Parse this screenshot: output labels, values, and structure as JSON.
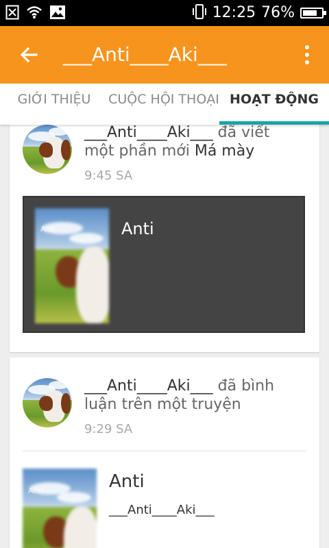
{
  "status_bar": {
    "time": "12:25",
    "battery": "76%",
    "battery_level": 0.76,
    "icons": [
      "close-box-icon",
      "wifi-icon",
      "image-icon",
      "vibrate-icon",
      "battery-icon"
    ]
  },
  "app_bar": {
    "title": "___Anti____Aki___",
    "back_icon": "arrow-back-icon",
    "menu_icon": "more-vert-icon",
    "color": "#f7941d"
  },
  "tabs": [
    {
      "label": "GIỚI THIỆU",
      "active": false
    },
    {
      "label": "CUỘC HỘI THOẠI",
      "active": false
    },
    {
      "label": "HOẠT ĐỘNG",
      "active": true
    }
  ],
  "accent_color": "#1aa3a3",
  "activities": [
    {
      "user": "___Anti____Aki___",
      "action": "đã viết một phần mới",
      "object": "Má mày",
      "time": "9:45 SA",
      "story": {
        "title": "Anti",
        "watermark": "Anti"
      }
    },
    {
      "user": "___Anti____Aki___",
      "action": "đã bình luận trên một truyện",
      "time": "9:29 SA",
      "story": {
        "title": "Anti",
        "author": "___Anti____Aki___",
        "watermark": "Anti"
      }
    }
  ]
}
